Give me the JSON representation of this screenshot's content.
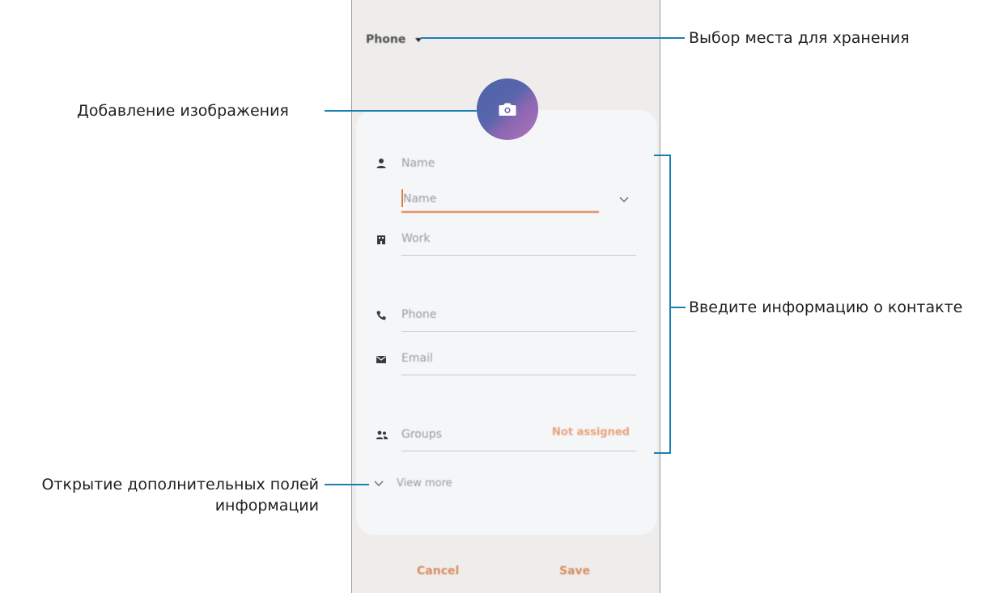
{
  "screen": {
    "storage_selector": "Phone",
    "fields": {
      "name_label": "Name",
      "name_placeholder": "Name",
      "work_label": "Work",
      "phone_label": "Phone",
      "email_label": "Email",
      "groups_label": "Groups",
      "groups_value": "Not assigned"
    },
    "view_more": "View more",
    "cancel": "Cancel",
    "save": "Save"
  },
  "callouts": {
    "storage": "Выбор места для хранения",
    "image": "Добавление изображения",
    "contact_info": "Введите информацию о контакте",
    "more_fields_line1": "Открытие дополнительных полей",
    "more_fields_line2": "информации"
  },
  "icons": {
    "camera": "camera-icon",
    "person": "person-icon",
    "work": "building-icon",
    "phone": "phone-icon",
    "email": "email-icon",
    "groups": "groups-icon",
    "expand": "chevron-down-icon",
    "storage_dropdown": "caret-down-icon"
  },
  "colors": {
    "accent": "#e07b3f",
    "callout_line": "#1b7fb3",
    "groups_value": "#e8a27a",
    "screen_background": "#eeedec",
    "card_background": "#f4f6f8"
  }
}
